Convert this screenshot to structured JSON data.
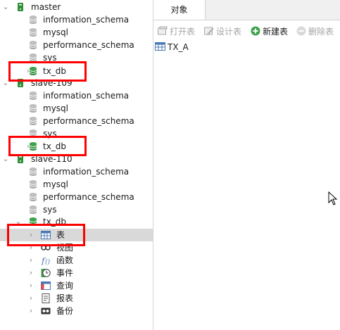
{
  "tree": {
    "connections": [
      {
        "name": "master",
        "databases": [
          "information_schema",
          "mysql",
          "performance_schema",
          "sys",
          "tx_db"
        ]
      },
      {
        "name": "slave-109",
        "databases": [
          "information_schema",
          "mysql",
          "performance_schema",
          "sys",
          "tx_db"
        ]
      },
      {
        "name": "slave-110",
        "databases": [
          "information_schema",
          "mysql",
          "performance_schema",
          "sys",
          "tx_db"
        ],
        "expanded_db_children": [
          "表",
          "视图",
          "函数",
          "事件",
          "查询",
          "报表",
          "备份"
        ]
      }
    ],
    "icons": {
      "connection": "server-icon",
      "database_closed": "database-gray-icon",
      "database_open": "database-green-icon",
      "tables": "table-icon",
      "views": "view-icon",
      "functions": "function-icon",
      "events": "event-clock-icon",
      "queries": "query-icon",
      "reports": "report-icon",
      "backups": "backup-icon"
    },
    "highlight_color": "#ff0000",
    "selected_row_color": "#d9d9d9"
  },
  "right": {
    "tab_label": "对象",
    "toolbar": {
      "open_label": "打开表",
      "design_label": "设计表",
      "new_label": "新建表",
      "delete_label": "删除表"
    },
    "objects": [
      "TX_A"
    ]
  }
}
